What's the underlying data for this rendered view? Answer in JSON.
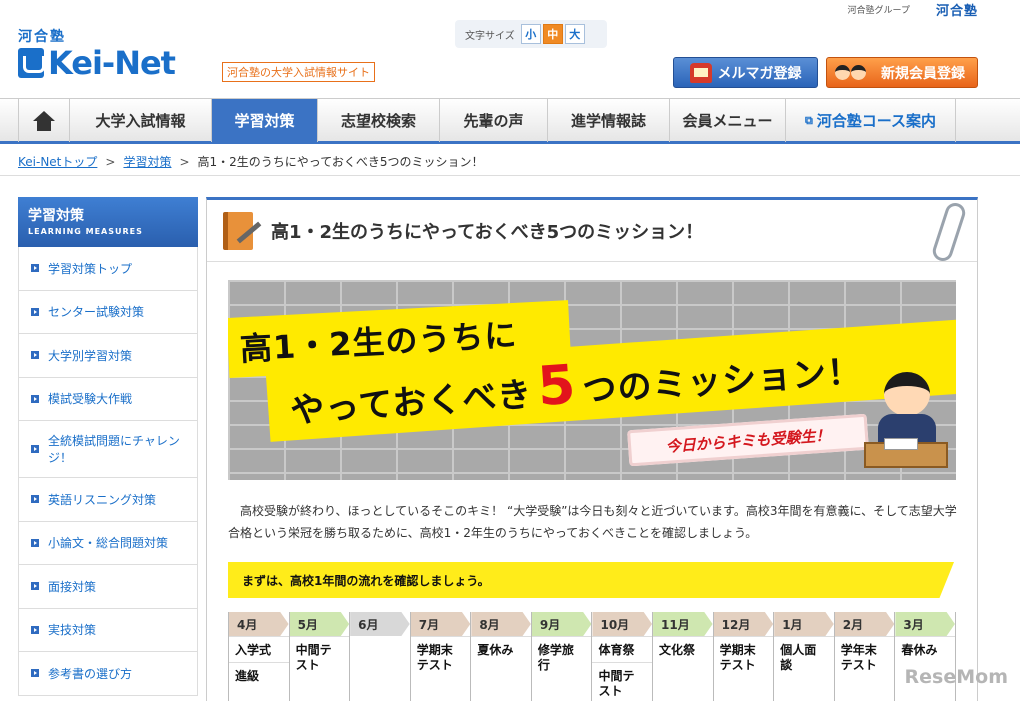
{
  "topbar": {
    "group_label": "河合塾グループ",
    "brand": "河合塾"
  },
  "header": {
    "logo_kanji": "河合塾",
    "logo_text": "Kei-Net",
    "tagline": "河合塾の大学入試情報サイト",
    "font_size": {
      "label": "文字サイズ",
      "options": [
        "小",
        "中",
        "大"
      ],
      "selected": "中"
    },
    "mail_button": "メルマガ登録",
    "member_button": "新規会員登録"
  },
  "nav": {
    "items": [
      "大学入試情報",
      "学習対策",
      "志望校検索",
      "先輩の声",
      "進学情報誌",
      "会員メニュー",
      "河合塾コース案内"
    ],
    "active": "学習対策"
  },
  "breadcrumb": {
    "home": "Kei-Netトップ",
    "section": "学習対策",
    "current": "高1・2生のうちにやっておくべき5つのミッション！"
  },
  "sidebar": {
    "title": "学習対策",
    "subtitle": "LEARNING MEASURES",
    "items": [
      "学習対策トップ",
      "センター試験対策",
      "大学別学習対策",
      "模試受験大作戦",
      "全統模試問題にチャレンジ！",
      "英語リスニング対策",
      "小論文・総合問題対策",
      "面接対策",
      "実技対策",
      "参考書の選び方"
    ]
  },
  "main": {
    "title": "高1・2生のうちにやっておくべき5つのミッション！",
    "hero": {
      "line1": "高1・2生のうちに",
      "line2_pre": "やっておくべき",
      "line2_num": "5",
      "line2_post": "つのミッション！",
      "ribbon": "今日からキミも受験生！"
    },
    "intro": "高校受験が終わり、ほっとしているそこのキミ！ “大学受験”は今日も刻々と近づいています。高校3年間を有意義に、そして志望大学合格という栄冠を勝ち取るために、高校1・2年生のうちにやっておくべきことを確認しましょう。",
    "section_banner": "まずは、高校1年間の流れを確認しましょう。",
    "timeline": [
      {
        "month": "4月",
        "color": "c1",
        "events": [
          "入学式",
          "進級"
        ]
      },
      {
        "month": "5月",
        "color": "c2",
        "events": [
          "中間テスト"
        ]
      },
      {
        "month": "6月",
        "color": "c3",
        "events": []
      },
      {
        "month": "7月",
        "color": "c1",
        "events": [
          "学期末テスト"
        ]
      },
      {
        "month": "8月",
        "color": "c1",
        "events": [
          "夏休み"
        ]
      },
      {
        "month": "9月",
        "color": "c2",
        "events": [
          "修学旅行"
        ]
      },
      {
        "month": "10月",
        "color": "c1",
        "events": [
          "体育祭",
          "中間テスト"
        ]
      },
      {
        "month": "11月",
        "color": "c2",
        "events": [
          "文化祭"
        ]
      },
      {
        "month": "12月",
        "color": "c1",
        "events": [
          "学期末テスト"
        ]
      },
      {
        "month": "1月",
        "color": "c1",
        "events": [
          "個人面談"
        ]
      },
      {
        "month": "2月",
        "color": "c1",
        "events": [
          "学年末テスト"
        ]
      },
      {
        "month": "3月",
        "color": "c2",
        "events": [
          "春休み"
        ]
      }
    ]
  },
  "watermark": "ReseMom"
}
